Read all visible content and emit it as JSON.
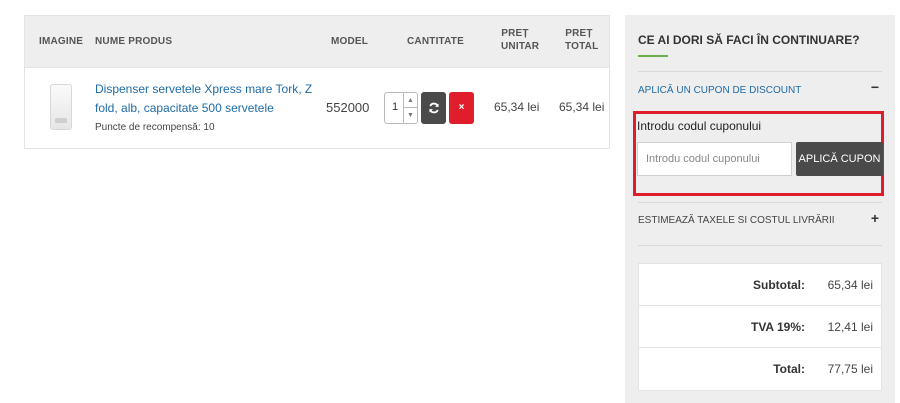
{
  "cart": {
    "headers": {
      "image": "IMAGINE",
      "name": "NUME PRODUS",
      "model": "MODEL",
      "quantity": "CANTITATE",
      "unit_price_1": "PREȚ",
      "unit_price_2": "UNITAR",
      "total_price_1": "PREȚ",
      "total_price_2": "TOTAL"
    },
    "item": {
      "name": "Dispenser servetele Xpress mare Tork, Z fold, alb, capacitate 500 servetele",
      "points": "Puncte de recompensă: 10",
      "model": "552000",
      "quantity": "1",
      "unit_price": "65,34 lei",
      "total_price": "65,34 lei",
      "refresh_icon": "refresh-icon",
      "remove_label": "×"
    }
  },
  "sidebar": {
    "title": "CE AI DORI SĂ FACI ÎN CONTINUARE?",
    "coupon": {
      "title": "APLICĂ UN CUPON DE DISCOUNT",
      "toggle": "−",
      "label": "Introdu codul cuponului",
      "placeholder": "Introdu codul cuponului",
      "value": "",
      "button": "APLICĂ CUPON"
    },
    "shipping": {
      "title": "ESTIMEAZĂ TAXELE SI COSTUL LIVRĂRII",
      "toggle": "+"
    },
    "totals": [
      {
        "label": "Subtotal:",
        "value": "65,34 lei"
      },
      {
        "label": "TVA 19%:",
        "value": "12,41 lei"
      },
      {
        "label": "Total:",
        "value": "77,75 lei"
      }
    ]
  },
  "colors": {
    "link": "#1f6aa5",
    "accent_green": "#6ab04c",
    "danger": "#e01e2b",
    "dark_button": "#4a4a4a"
  }
}
